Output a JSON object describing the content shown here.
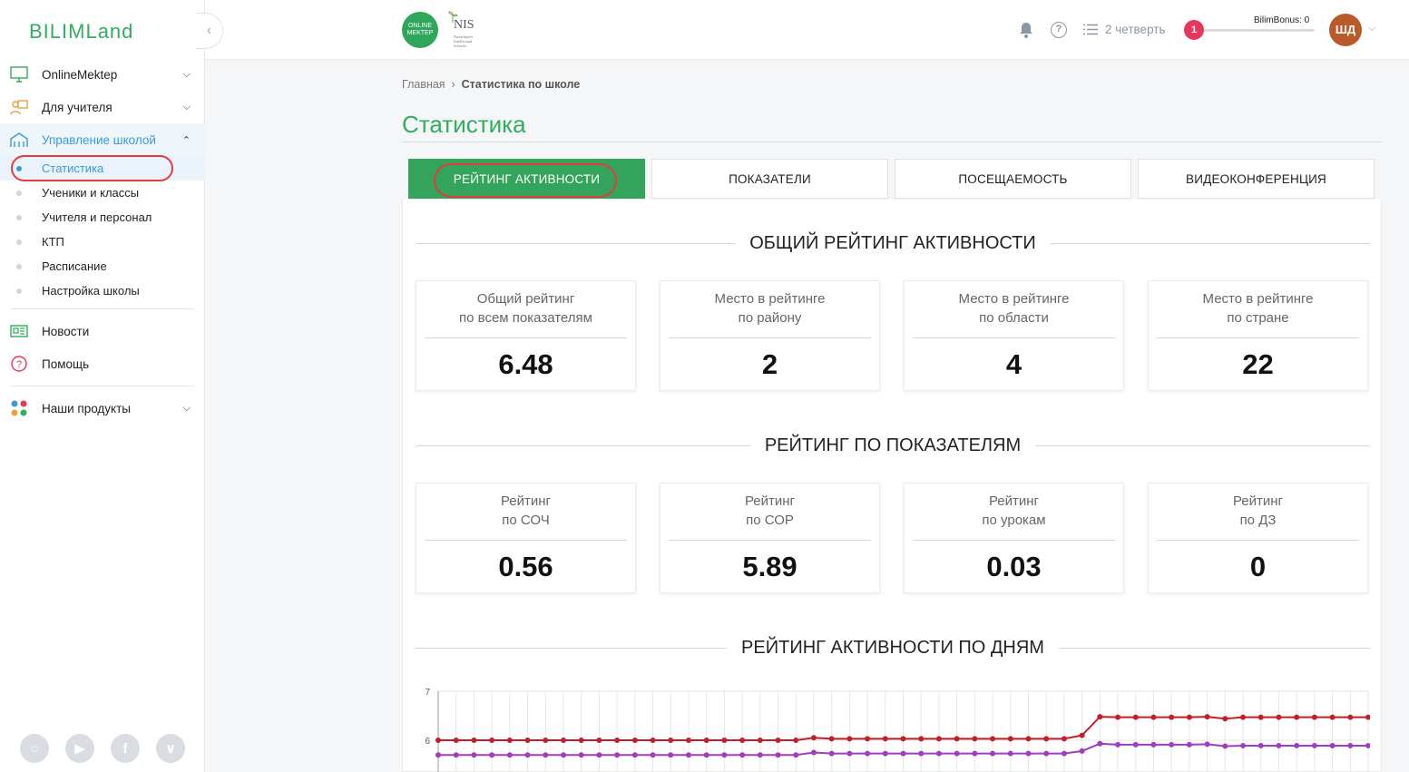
{
  "sidebar": {
    "logo": "BILIMLand",
    "items": [
      {
        "label": "OnlineMektep"
      },
      {
        "label": "Для учителя"
      },
      {
        "label": "Управление школой"
      }
    ],
    "subitems": [
      {
        "label": "Статистика"
      },
      {
        "label": "Ученики и классы"
      },
      {
        "label": "Учителя и персонал"
      },
      {
        "label": "КТП"
      },
      {
        "label": "Расписание"
      },
      {
        "label": "Настройка школы"
      }
    ],
    "extra": [
      {
        "label": "Новости"
      },
      {
        "label": "Помощь"
      }
    ],
    "products": {
      "label": "Наши продукты"
    }
  },
  "topbar": {
    "online_mektep_logo": "ONLINE MEKTEP",
    "nis_logo": "NIS",
    "nis_sub": "Nazarbayev Intellectual Schools",
    "quarter": "2 четверть",
    "bonus_badge": "1",
    "bonus_label": "BilimBonus: 0",
    "avatar": "ШД"
  },
  "breadcrumb": {
    "home": "Главная",
    "current": "Статистика по школе"
  },
  "page_title": "Статистика",
  "tabs": [
    "РЕЙТИНГ АКТИВНОСТИ",
    "ПОКАЗАТЕЛИ",
    "ПОСЕЩАЕМОСТЬ",
    "ВИДЕОКОНФЕРЕНЦИЯ"
  ],
  "sections": {
    "overall": {
      "title": "ОБЩИЙ РЕЙТИНГ АКТИВНОСТИ",
      "cards": [
        {
          "line1": "Общий рейтинг",
          "line2": "по всем показателям",
          "value": "6.48"
        },
        {
          "line1": "Место в рейтинге",
          "line2": "по району",
          "value": "2"
        },
        {
          "line1": "Место в рейтинге",
          "line2": "по области",
          "value": "4"
        },
        {
          "line1": "Место в рейтинге",
          "line2": "по стране",
          "value": "22"
        }
      ]
    },
    "indicators": {
      "title": "РЕЙТИНГ ПО ПОКАЗАТЕЛЯМ",
      "cards": [
        {
          "line1": "Рейтинг",
          "line2": "по СОЧ",
          "value": "0.56"
        },
        {
          "line1": "Рейтинг",
          "line2": "по СОР",
          "value": "5.89"
        },
        {
          "line1": "Рейтинг",
          "line2": "по урокам",
          "value": "0.03"
        },
        {
          "line1": "Рейтинг",
          "line2": "по ДЗ",
          "value": "0"
        }
      ]
    },
    "daily": {
      "title": "РЕЙТИНГ АКТИВНОСТИ ПО ДНЯМ"
    }
  },
  "colors": {
    "accent": "#34a35c",
    "link": "#3a9bd8",
    "series1": "#c0202a",
    "series2": "#a03cc0",
    "highlight": "#e23c3c"
  },
  "chart_data": {
    "type": "line",
    "title": "РЕЙТИНГ АКТИВНОСТИ ПО ДНЯМ",
    "ylim": [
      5.5,
      7
    ],
    "yticks": [
      "7",
      "6"
    ],
    "grid": true,
    "series": [
      {
        "values": [
          6.0,
          6.0,
          6.0,
          6.0,
          6.0,
          6.0,
          6.0,
          6.0,
          6.0,
          6.0,
          6.0,
          6.0,
          6.0,
          6.0,
          6.0,
          6.0,
          6.0,
          6.0,
          6.0,
          6.0,
          6.0,
          6.05,
          6.03,
          6.03,
          6.03,
          6.03,
          6.03,
          6.03,
          6.03,
          6.03,
          6.03,
          6.03,
          6.03,
          6.03,
          6.03,
          6.03,
          6.1,
          6.48,
          6.47,
          6.47,
          6.47,
          6.47,
          6.47,
          6.48,
          6.44,
          6.47,
          6.47,
          6.47,
          6.47,
          6.47,
          6.47,
          6.47,
          6.47
        ]
      },
      {
        "values": [
          5.7,
          5.7,
          5.7,
          5.7,
          5.7,
          5.7,
          5.7,
          5.7,
          5.7,
          5.7,
          5.7,
          5.7,
          5.7,
          5.7,
          5.7,
          5.7,
          5.7,
          5.7,
          5.7,
          5.7,
          5.7,
          5.75,
          5.73,
          5.73,
          5.73,
          5.73,
          5.73,
          5.73,
          5.73,
          5.73,
          5.73,
          5.73,
          5.73,
          5.73,
          5.73,
          5.73,
          5.78,
          5.93,
          5.91,
          5.91,
          5.91,
          5.91,
          5.91,
          5.92,
          5.88,
          5.89,
          5.89,
          5.89,
          5.89,
          5.89,
          5.89,
          5.89,
          5.89
        ]
      }
    ]
  }
}
